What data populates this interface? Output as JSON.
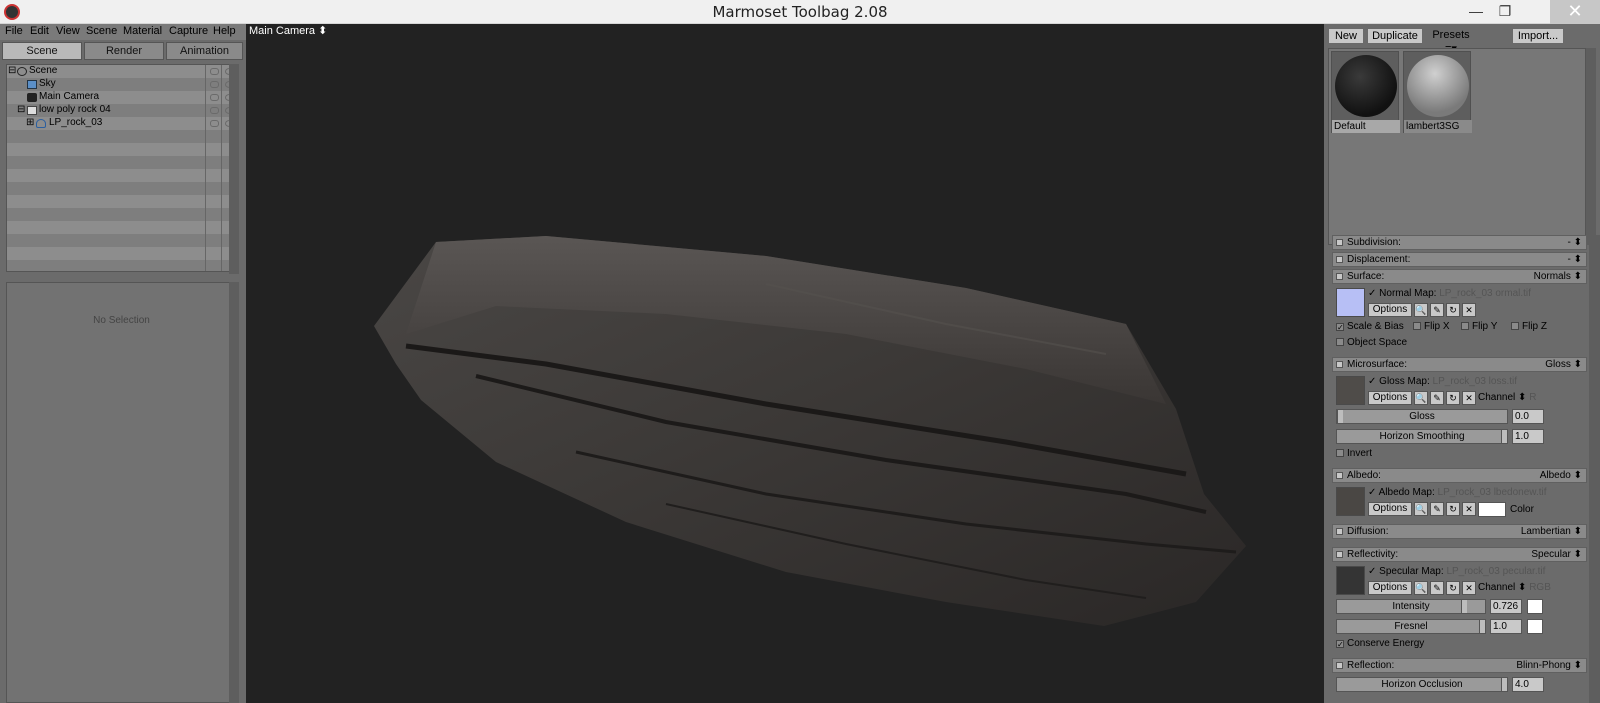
{
  "window": {
    "title": "Marmoset Toolbag 2.08",
    "minimize": "—",
    "maximize": "❐",
    "close": "✕"
  },
  "menu": [
    "File",
    "Edit",
    "View",
    "Scene",
    "Material",
    "Capture",
    "Help"
  ],
  "tabs": [
    "Scene",
    "Render",
    "Animation"
  ],
  "outliner": {
    "items": [
      {
        "label": "Scene",
        "icon": "scene-icon",
        "expander": "⊟"
      },
      {
        "label": "Sky",
        "icon": "sky-icon",
        "expander": ""
      },
      {
        "label": "Main Camera",
        "icon": "camera-icon",
        "expander": ""
      },
      {
        "label": "low poly rock 04",
        "icon": "file-icon",
        "expander": "⊟"
      },
      {
        "label": "LP_rock_03",
        "icon": "mesh-icon",
        "expander": "⊞"
      }
    ]
  },
  "properties": {
    "empty_text": "No Selection"
  },
  "viewport": {
    "camera_label": "Main Camera ⬍"
  },
  "materials": {
    "buttons": {
      "new": "New",
      "duplicate": "Duplicate",
      "presets": "Presets ≡▾",
      "import": "Import..."
    },
    "items": [
      {
        "name": "Default"
      },
      {
        "name": "lambert3SG"
      }
    ]
  },
  "sections": {
    "subdivision": {
      "name": "Subdivision:",
      "value": "- ⬍"
    },
    "displacement": {
      "name": "Displacement:",
      "value": "- ⬍"
    },
    "surface": {
      "name": "Surface:",
      "value": "Normals ⬍",
      "map_title": "Normal Map:",
      "map_file": "LP_rock_03 ormal.tif",
      "options": "Options",
      "checks": {
        "scale_bias": "Scale & Bias",
        "flip_x": "Flip X",
        "flip_y": "Flip Y",
        "flip_z": "Flip Z",
        "object_space": "Object Space"
      }
    },
    "microsurface": {
      "name": "Microsurface:",
      "value": "Gloss ⬍",
      "map_title": "Gloss Map:",
      "map_file": "LP_rock_03 loss.tif",
      "options": "Options",
      "channel": "Channel ⬍",
      "channel_value": "R",
      "gloss_label": "Gloss",
      "gloss_value": "0.0",
      "horizon_label": "Horizon Smoothing",
      "horizon_value": "1.0",
      "invert": "Invert"
    },
    "albedo": {
      "name": "Albedo:",
      "value": "Albedo ⬍",
      "map_title": "Albedo Map:",
      "map_file": "LP_rock_03 lbedonew.tif",
      "options": "Options",
      "color_label": "Color"
    },
    "diffusion": {
      "name": "Diffusion:",
      "value": "Lambertian ⬍"
    },
    "reflectivity": {
      "name": "Reflectivity:",
      "value": "Specular ⬍",
      "map_title": "Specular Map:",
      "map_file": "LP_rock_03 pecular.tif",
      "options": "Options",
      "channel": "Channel ⬍",
      "channel_value": "RGB",
      "intensity_label": "Intensity",
      "intensity_value": "0.726",
      "fresnel_label": "Fresnel",
      "fresnel_value": "1.0",
      "conserve": "Conserve Energy"
    },
    "reflection": {
      "name": "Reflection:",
      "value": "Blinn-Phong ⬍",
      "horizon_occlusion_label": "Horizon Occlusion",
      "horizon_occlusion_value": "4.0"
    }
  },
  "icon_buttons": {
    "search": "🔍",
    "edit": "✎",
    "reload": "↻",
    "remove": "✕"
  },
  "colors": {
    "viewport_bg": "#222222",
    "panel_bg": "#6b6b6b",
    "title_bar": "#f0f0f0"
  }
}
